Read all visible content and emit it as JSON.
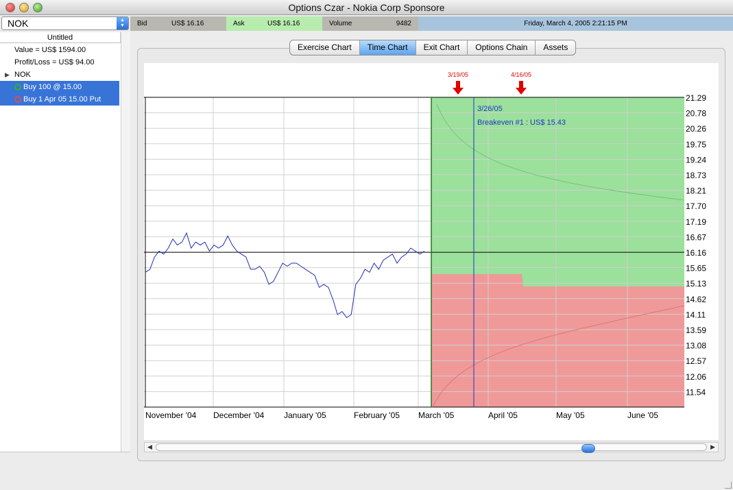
{
  "window": {
    "title": "Options Czar -  Nokia Corp Sponsore"
  },
  "symbol": {
    "value": "NOK"
  },
  "sidebar": {
    "header": "Untitled",
    "rows": [
      {
        "label": "Value = US$ 1594.00"
      },
      {
        "label": "Profit/Loss = US$ 94.00"
      },
      {
        "label": "NOK"
      },
      {
        "label": "Buy 100 @ 15.00"
      },
      {
        "label": "Buy 1 Apr 05 15.00 Put"
      }
    ]
  },
  "quote": {
    "bid_label": "Bid",
    "bid_value": "US$ 16.16",
    "ask_label": "Ask",
    "ask_value": "US$ 16.16",
    "volume_label": "Volume",
    "volume_value": "9482",
    "datetime": "Friday, March 4, 2005 2:21:15 PM"
  },
  "tabs": [
    {
      "label": "Exercise Chart",
      "active": false
    },
    {
      "label": "Time Chart",
      "active": true
    },
    {
      "label": "Exit Chart",
      "active": false
    },
    {
      "label": "Options Chain",
      "active": false
    },
    {
      "label": "Assets",
      "active": false
    }
  ],
  "colors": {
    "profit": "#9be09b",
    "loss": "#f09999",
    "price": "#1f2fb0",
    "marker": "#e00000",
    "cursor": "#2233cc"
  },
  "chart_data": {
    "type": "line",
    "x_labels": [
      "November '04",
      "December '04",
      "January '05",
      "February '05",
      "March '05",
      "April '05",
      "May '05",
      "June '05"
    ],
    "y_ticks": [
      "21.29",
      "20.78",
      "20.26",
      "19.75",
      "19.24",
      "18.73",
      "18.21",
      "17.70",
      "17.19",
      "16.67",
      "16.16",
      "15.65",
      "15.13",
      "14.62",
      "14.11",
      "13.59",
      "13.08",
      "12.57",
      "12.06",
      "11.54"
    ],
    "ylim": [
      11.03,
      21.29
    ],
    "current_price": 16.16,
    "markers": [
      {
        "label": "3/19/05"
      },
      {
        "label": "4/16/05"
      }
    ],
    "cursor": {
      "date": "3/26/05",
      "label": "Breakeven #1 : US$ 15.43"
    },
    "price_series": [
      15.5,
      15.6,
      16.0,
      16.2,
      16.1,
      16.3,
      16.6,
      16.4,
      16.5,
      16.8,
      16.3,
      16.5,
      16.4,
      16.5,
      16.2,
      16.4,
      16.3,
      16.4,
      16.7,
      16.4,
      16.2,
      16.1,
      16.0,
      15.6,
      15.6,
      15.7,
      15.5,
      15.1,
      15.2,
      15.5,
      15.8,
      15.7,
      15.8,
      15.8,
      15.7,
      15.6,
      15.5,
      15.4,
      15.0,
      15.1,
      15.0,
      14.6,
      14.1,
      14.2,
      14.0,
      14.1,
      15.1,
      15.3,
      15.6,
      15.5,
      15.8,
      15.6,
      15.9,
      16.0,
      16.1,
      15.8,
      16.0,
      16.1,
      16.3,
      16.2,
      16.1,
      16.2
    ]
  }
}
